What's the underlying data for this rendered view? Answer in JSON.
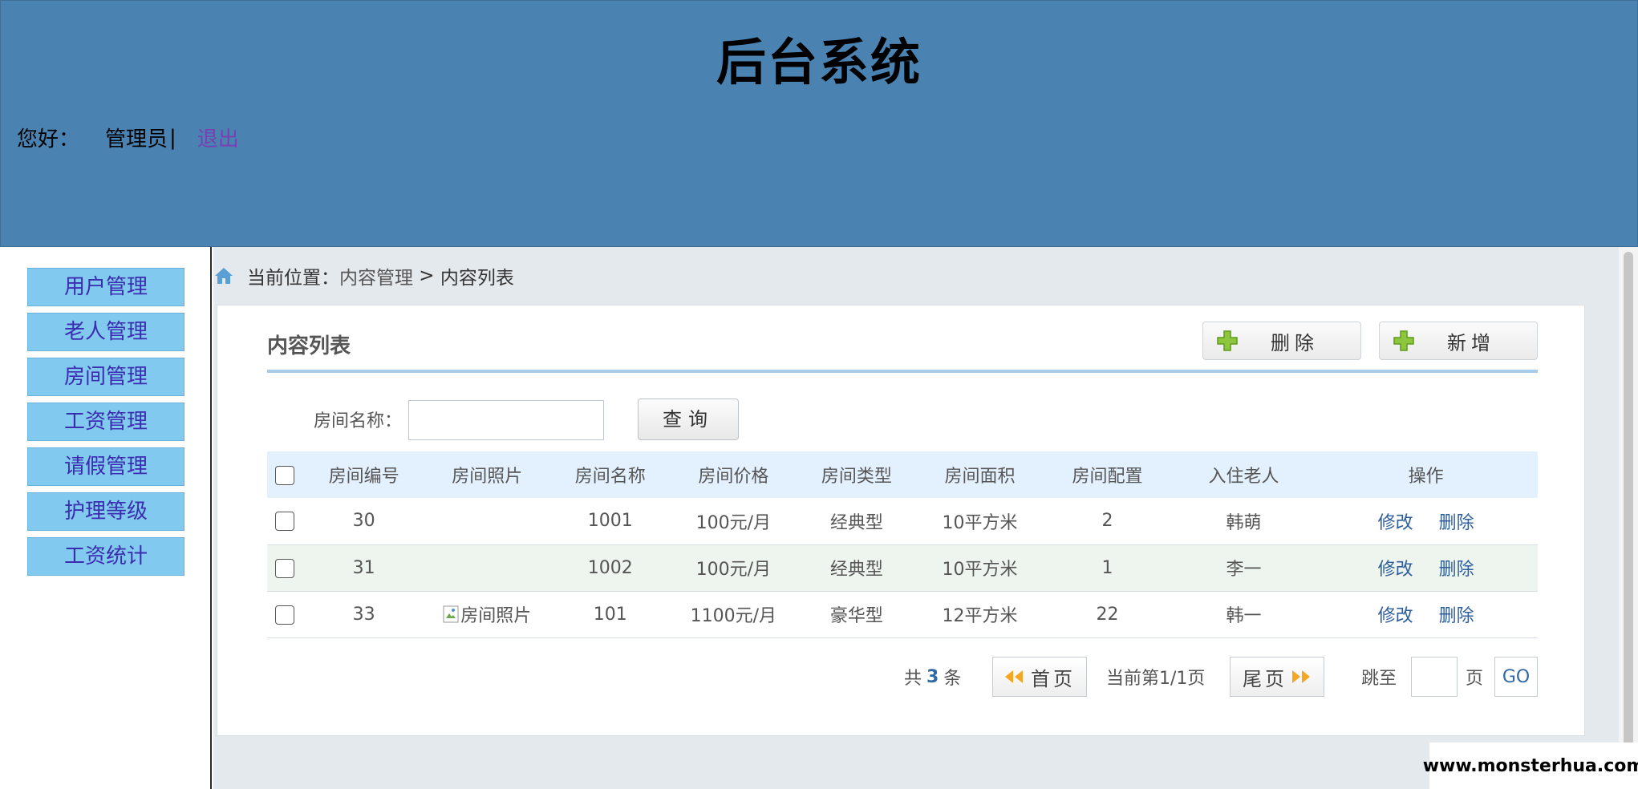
{
  "header": {
    "title": "后台系统",
    "greeting": "您好：",
    "username": "管理员",
    "separator": "|",
    "logout": "退出",
    "bg_color": "#4a82b2"
  },
  "sidebar": {
    "items": [
      {
        "label": "用户管理"
      },
      {
        "label": "老人管理"
      },
      {
        "label": "房间管理"
      },
      {
        "label": "工资管理"
      },
      {
        "label": "请假管理"
      },
      {
        "label": "护理等级"
      },
      {
        "label": "工资统计"
      }
    ],
    "item_color": "#82c9ef"
  },
  "breadcrumb": {
    "icon": "home-icon",
    "prefix": "当前位置：",
    "section": "内容管理",
    "separator": " > ",
    "current": "内容列表"
  },
  "panel": {
    "title": "内容列表",
    "delete_label": "删除",
    "add_label": "新增",
    "button_icon": "plus-icon"
  },
  "search": {
    "label": "房间名称：",
    "value": "",
    "placeholder": "",
    "button_label": "查询"
  },
  "table": {
    "headers": [
      "房间编号",
      "房间照片",
      "房间名称",
      "房间价格",
      "房间类型",
      "房间面积",
      "房间配置",
      "入住老人",
      "操作"
    ],
    "rows": [
      {
        "id": "30",
        "photo": "",
        "name": "1001",
        "price": "100元/月",
        "type": "经典型",
        "area": "10平方米",
        "config": "2",
        "resident": "韩萌",
        "edit": "修改",
        "delete": "删除"
      },
      {
        "id": "31",
        "photo": "",
        "name": "1002",
        "price": "100元/月",
        "type": "经典型",
        "area": "10平方米",
        "config": "1",
        "resident": "李一",
        "edit": "修改",
        "delete": "删除"
      },
      {
        "id": "33",
        "photo": "房间照片",
        "name": "101",
        "price": "1100元/月",
        "type": "豪华型",
        "area": "12平方米",
        "config": "22",
        "resident": "韩一",
        "edit": "修改",
        "delete": "删除"
      }
    ]
  },
  "pager": {
    "total_prefix": "共",
    "total": "3",
    "total_suffix": "条",
    "first_label": "首页",
    "current_text": "当前第1/1页",
    "last_label": "尾页",
    "jump_label": "跳至",
    "page_unit": "页",
    "jump_value": "",
    "go_label": "GO"
  },
  "watermark": "www.monsterhua.com"
}
